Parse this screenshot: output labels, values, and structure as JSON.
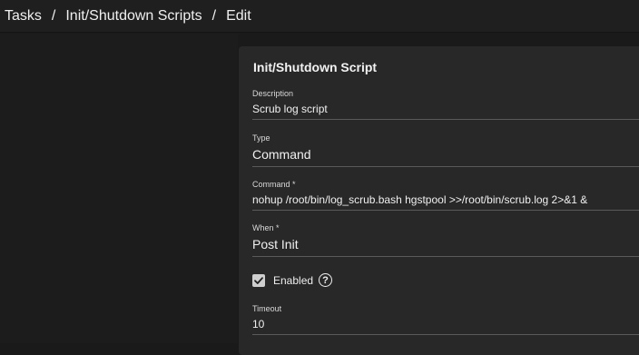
{
  "breadcrumb": {
    "items": [
      "Tasks",
      "Init/Shutdown Scripts",
      "Edit"
    ],
    "separator": "/"
  },
  "form": {
    "title": "Init/Shutdown Script",
    "description": {
      "label": "Description",
      "value": "Scrub log script"
    },
    "type": {
      "label": "Type",
      "value": "Command"
    },
    "command": {
      "label": "Command *",
      "value": "nohup /root/bin/log_scrub.bash hgstpool >>/root/bin/scrub.log 2>&1 &"
    },
    "when": {
      "label": "When *",
      "value": "Post Init"
    },
    "enabled": {
      "label": "Enabled",
      "checked": true,
      "help_icon": "help-circle-icon"
    },
    "timeout": {
      "label": "Timeout",
      "value": "10"
    }
  },
  "colors": {
    "background": "#1a1a1a",
    "topbar": "#1f1f1f",
    "card": "#282828",
    "text": "#f0f0f0",
    "underline": "#5a5a5a"
  }
}
